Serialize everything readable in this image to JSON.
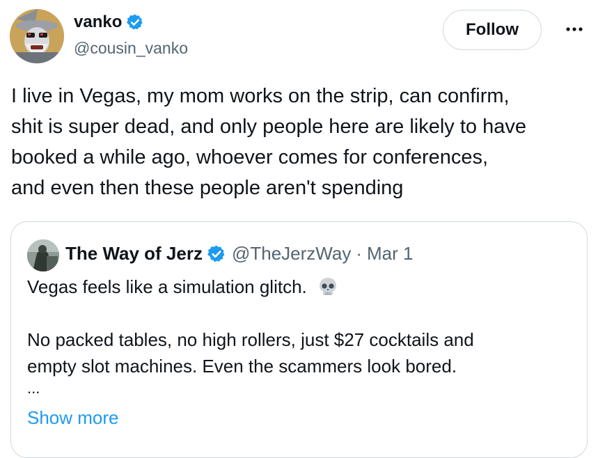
{
  "author": {
    "display_name": "vanko",
    "handle": "@cousin_vanko",
    "verified": true
  },
  "actions": {
    "follow_label": "Follow",
    "more_icon": "more-horizontal-icon"
  },
  "tweet": {
    "lines": [
      "I live in Vegas, my mom works on the strip, can confirm,",
      "shit is super dead, and only people here are likely to have",
      "booked a while ago, whoever comes for conferences,",
      "and even then these people aren't spending"
    ]
  },
  "quote": {
    "display_name": "The Way of Jerz",
    "handle": "@TheJerzWay",
    "separator": "·",
    "date": "Mar 1",
    "verified": true,
    "line1": "Vegas feels like a simulation glitch.",
    "emoji": "skull-emoji",
    "line2": "No packed tables, no high rollers, just $27 cocktails and",
    "line3": "empty slot machines. Even the scammers look bored.",
    "ellipsis": "...",
    "show_more": "Show more"
  },
  "colors": {
    "text_primary": "#0f1419",
    "text_secondary": "#536471",
    "link": "#1d9bf0",
    "border": "#cfd9de",
    "verified_badge": "#1d9bf0"
  }
}
